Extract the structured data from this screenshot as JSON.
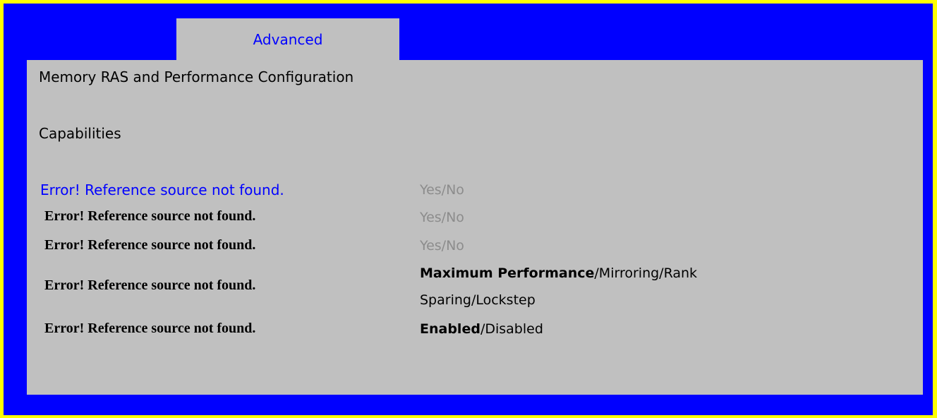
{
  "tab": {
    "label": "Advanced"
  },
  "page": {
    "title": "Memory RAS and Performance Configuration",
    "section": "Capabilities"
  },
  "rows": [
    {
      "label": "Error! Reference source not found.",
      "value": "Yes/No"
    },
    {
      "label": "Error! Reference source not found.",
      "value": "Yes/No"
    },
    {
      "label": "Error! Reference source not found.",
      "value": "Yes/No"
    },
    {
      "label": "Error! Reference source not found.",
      "value_selected": "Maximum Performance",
      "value_rest_line1": "/Mirroring/Rank",
      "value_line2": "Sparing/Lockstep"
    },
    {
      "label": "Error! Reference source not found.",
      "value_selected": "Enabled",
      "value_rest_line1": "/Disabled"
    }
  ],
  "colors": {
    "border": "#ffff00",
    "background": "#0000ff",
    "panel": "#c0c0c0",
    "highlight_text": "#0000ff",
    "disabled_text": "#8c8c8c"
  }
}
